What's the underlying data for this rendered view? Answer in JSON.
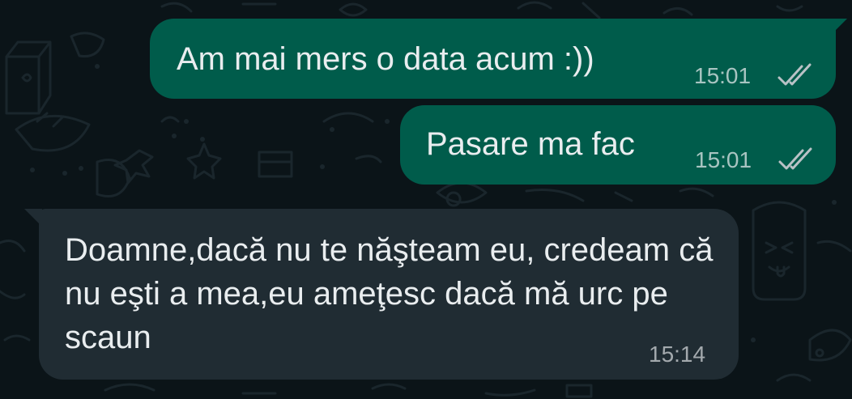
{
  "messages": [
    {
      "direction": "outgoing",
      "text": "Am mai mers o data acum :))",
      "time": "15:01",
      "status_icon": "read-double-check-icon"
    },
    {
      "direction": "outgoing",
      "text": "Pasare ma fac",
      "time": "15:01",
      "status_icon": "read-double-check-icon"
    },
    {
      "direction": "incoming",
      "text": "Doamne,dacă nu te năşteam eu, credeam că nu eşti a mea,eu ameţesc dacă mă urc pe scaun",
      "time": "15:14"
    }
  ],
  "colors": {
    "background": "#0b1418",
    "outgoing_bubble": "#005c4b",
    "incoming_bubble": "#202c33",
    "text": "#e9edef",
    "meta_text": "#b7c0c4"
  }
}
